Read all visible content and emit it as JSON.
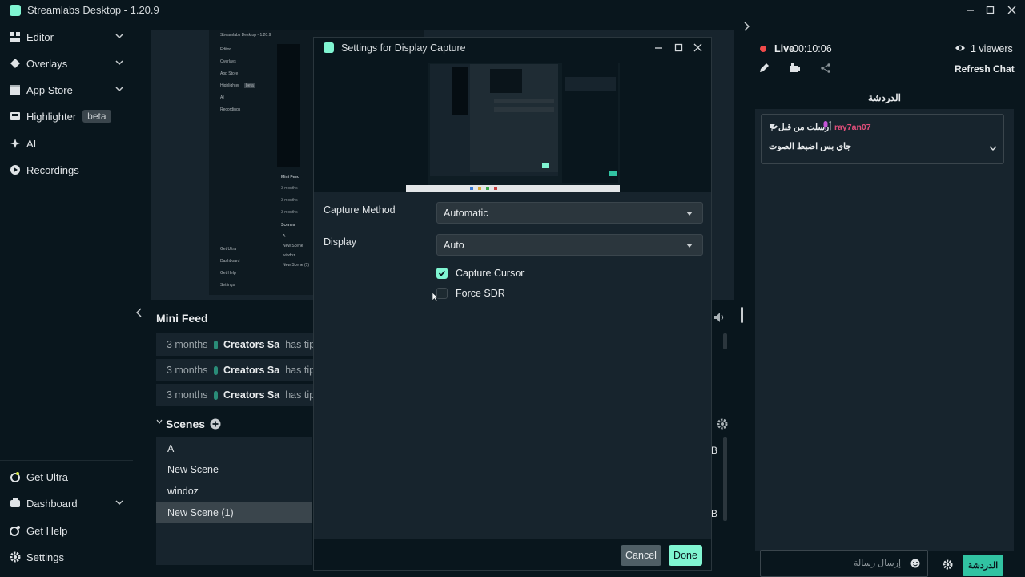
{
  "window": {
    "title": "Streamlabs Desktop - 1.20.9"
  },
  "sidebar": {
    "items": [
      {
        "label": "Editor",
        "icon": "editor-icon"
      },
      {
        "label": "Overlays",
        "icon": "overlays-icon"
      },
      {
        "label": "App Store",
        "icon": "store-icon"
      },
      {
        "label": "Highlighter",
        "icon": "highlighter-icon",
        "badge": "beta"
      },
      {
        "label": "AI",
        "icon": "ai-sparkle-icon"
      },
      {
        "label": "Recordings",
        "icon": "play-icon"
      }
    ],
    "bottom": [
      {
        "label": "Get Ultra",
        "icon": "ultra-icon"
      },
      {
        "label": "Dashboard",
        "icon": "dashboard-icon"
      },
      {
        "label": "Get Help",
        "icon": "help-icon"
      },
      {
        "label": "Settings",
        "icon": "gear-icon"
      }
    ]
  },
  "preview_mirror": {
    "title": "Streamlabs Desktop - 1.20.9",
    "nav": [
      "Editor",
      "Overlays",
      "App Store",
      "Highlighter",
      "AI",
      "Recordings"
    ],
    "badge": "beta",
    "bottom": [
      "Get Ultra",
      "Dashboard",
      "Get Help",
      "Settings"
    ],
    "mini_feed_title": "Mini Feed",
    "feed_times": [
      "3 months",
      "3 months",
      "3 months"
    ],
    "scenes_title": "Scenes",
    "scenes": [
      "A",
      "New Scene",
      "windoz",
      "New Scene (1)"
    ]
  },
  "mini_feed": {
    "title": "Mini Feed",
    "rows": [
      {
        "time": "3 months",
        "who": "Creators Sa",
        "action": "has tipp"
      },
      {
        "time": "3 months",
        "who": "Creators Sa",
        "action": "has tipp"
      },
      {
        "time": "3 months",
        "who": "Creators Sa",
        "action": "has tipp"
      }
    ]
  },
  "scenes": {
    "title": "Scenes",
    "items": [
      "A",
      "New Scene",
      "windoz",
      "New Scene (1)"
    ],
    "selected": "New Scene (1)",
    "partial_labels": [
      "B",
      "B"
    ]
  },
  "dialog": {
    "title": "Settings for Display Capture",
    "capture_method": {
      "label": "Capture Method",
      "value": "Automatic"
    },
    "display": {
      "label": "Display",
      "value": "Auto"
    },
    "capture_cursor": {
      "label": "Capture Cursor",
      "checked": true
    },
    "force_sdr": {
      "label": "Force SDR",
      "checked": false
    },
    "cancel_label": "Cancel",
    "done_label": "Done"
  },
  "chat": {
    "live_label": "Live",
    "live_time": "00:10:06",
    "viewers": "1 viewers",
    "refresh_label": "Refresh Chat",
    "tab_label": "الدردشة",
    "pinned": {
      "sent_by": "أرسلت من قبل",
      "user": "ray7an07",
      "message": "جاي بس اضبط الصوت"
    },
    "input_placeholder": "إرسال رسالة",
    "send_label": "الدردشة"
  },
  "colors": {
    "background": "#09161d",
    "panel": "#17242d",
    "accent": "#80f5d2",
    "live": "#f04a4a",
    "mic": "#c454d6",
    "username": "#e04e7a"
  }
}
